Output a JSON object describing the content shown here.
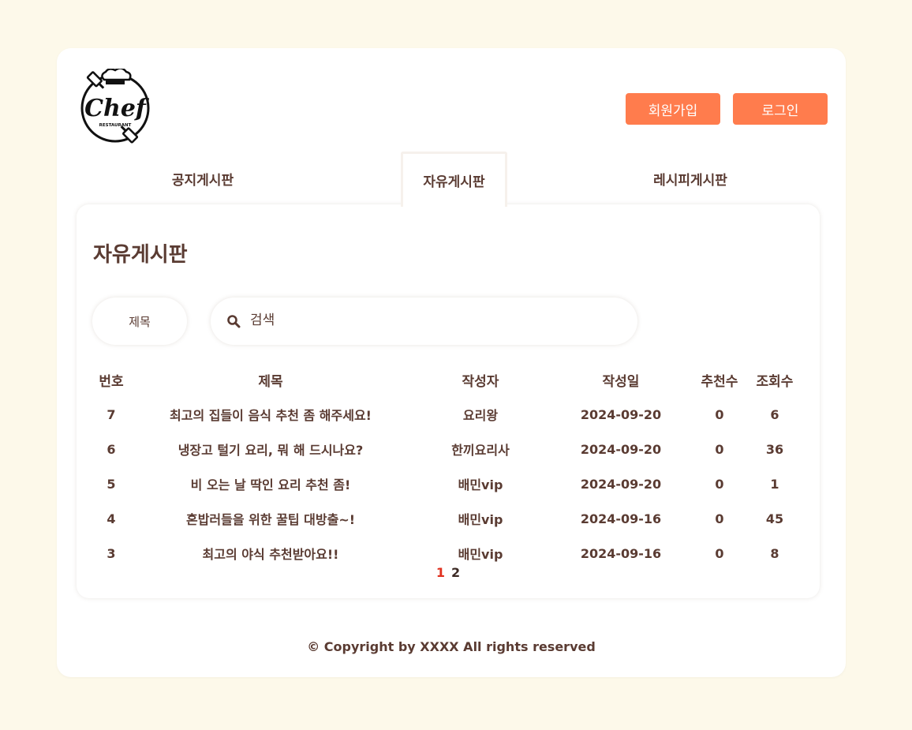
{
  "logo": {
    "icon": "chef-logo-icon",
    "text": "Chef",
    "subtext": "RESTAURANT"
  },
  "header": {
    "signup_label": "회원가입",
    "login_label": "로그인"
  },
  "tabs": [
    {
      "label": "공지게시판",
      "active": false
    },
    {
      "label": "자유게시판",
      "active": true
    },
    {
      "label": "레시피게시판",
      "active": false
    }
  ],
  "board": {
    "title": "자유게시판",
    "filter": {
      "selected": "제목"
    },
    "search": {
      "placeholder": "검색",
      "value": "",
      "icon": "search-icon"
    },
    "columns": [
      "번호",
      "제목",
      "작성자",
      "작성일",
      "추천수",
      "조회수"
    ],
    "rows": [
      {
        "no": "7",
        "title": "최고의 집들이 음식 추천 좀 해주세요!",
        "author": "요리왕",
        "date": "2024-09-20",
        "likes": "0",
        "views": "6"
      },
      {
        "no": "6",
        "title": "냉장고 털기 요리, 뭐 해 드시나요?",
        "author": "한끼요리사",
        "date": "2024-09-20",
        "likes": "0",
        "views": "36"
      },
      {
        "no": "5",
        "title": "비 오는 날 딱인 요리 추천 좀!",
        "author": "배민vip",
        "date": "2024-09-20",
        "likes": "0",
        "views": "1"
      },
      {
        "no": "4",
        "title": "혼밥러들을 위한 꿀팁 대방출~!",
        "author": "배민vip",
        "date": "2024-09-16",
        "likes": "0",
        "views": "45"
      },
      {
        "no": "3",
        "title": "최고의 야식 추천받아요!!",
        "author": "배민vip",
        "date": "2024-09-16",
        "likes": "0",
        "views": "8"
      }
    ],
    "pagination": {
      "pages": [
        "1",
        "2"
      ],
      "current": "1"
    }
  },
  "footer": {
    "text": "© Copyright by XXXX All rights reserved"
  },
  "colors": {
    "background": "#fdf9ea",
    "accent": "#ff7c4d",
    "text": "#5a3b32",
    "active_page": "#e0301e"
  }
}
